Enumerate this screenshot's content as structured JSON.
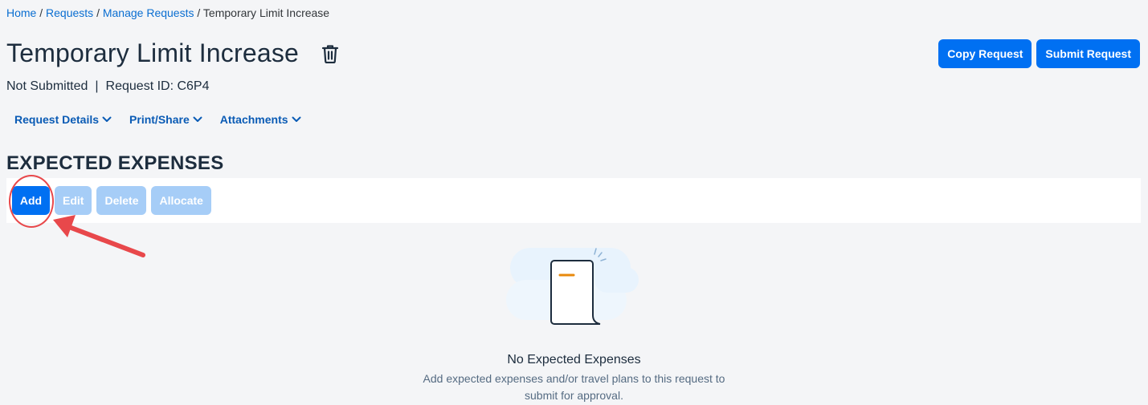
{
  "breadcrumb": {
    "items": [
      "Home",
      "Requests",
      "Manage Requests"
    ],
    "current": "Temporary Limit Increase",
    "separator": "/"
  },
  "header": {
    "title": "Temporary Limit Increase",
    "delete_icon": "trash-icon",
    "copy_label": "Copy Request",
    "submit_label": "Submit Request"
  },
  "status": {
    "state": "Not Submitted",
    "separator": "|",
    "request_id": "Request ID: C6P4"
  },
  "menus": [
    {
      "label": "Request Details",
      "icon": "chevron-down-icon"
    },
    {
      "label": "Print/Share",
      "icon": "chevron-down-icon"
    },
    {
      "label": "Attachments",
      "icon": "chevron-down-icon"
    }
  ],
  "expenses": {
    "section_title": "EXPECTED EXPENSES",
    "toolbar": {
      "add_label": "Add",
      "edit_label": "Edit",
      "delete_label": "Delete",
      "allocate_label": "Allocate"
    },
    "empty_title": "No Expected Expenses",
    "empty_desc_line1": "Add expected expenses and/or travel plans to this request to",
    "empty_desc_line2": "submit for approval."
  },
  "colors": {
    "primary": "#0070f2",
    "disabled": "#a6cdf7",
    "link": "#0a6ed1",
    "annotation": "#e8484b",
    "accent": "#e8890c"
  }
}
